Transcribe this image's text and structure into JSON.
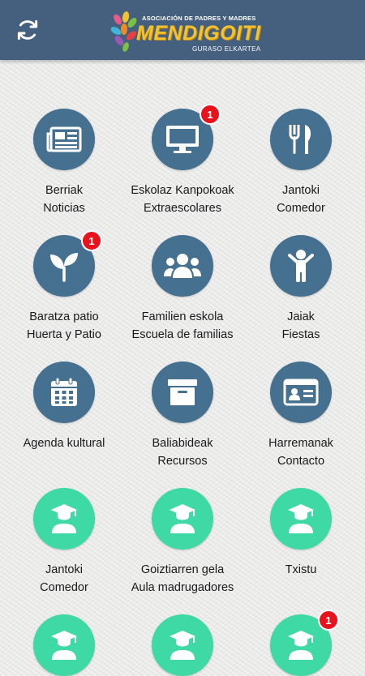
{
  "header": {
    "logo_top": "ASOCIACIÓN DE PADRES Y MADRES",
    "logo_main": "MENDIGOITI",
    "logo_sub": "GURASO ELKARTEA"
  },
  "colors": {
    "header_bg": "#45607e",
    "blue_circle": "#45708f",
    "teal_circle": "#3fd9a6",
    "badge": "#e8121c"
  },
  "tiles": [
    {
      "line1": "Berriak",
      "line2": "Noticias",
      "icon": "newspaper-icon",
      "badge": null
    },
    {
      "line1": "Eskolaz Kanpokoak",
      "line2": "Extraescolares",
      "icon": "monitor-icon",
      "badge": "1"
    },
    {
      "line1": "Jantoki",
      "line2": "Comedor",
      "icon": "fork-knife-icon",
      "badge": null
    },
    {
      "line1": "Baratza patio",
      "line2": "Huerta y Patio",
      "icon": "sprout-icon",
      "badge": "1"
    },
    {
      "line1": "Familien eskola",
      "line2": "Escuela de familias",
      "icon": "group-icon",
      "badge": null
    },
    {
      "line1": "Jaiak",
      "line2": "Fiestas",
      "icon": "child-icon",
      "badge": null
    },
    {
      "line1": "Agenda kultural",
      "line2": "",
      "icon": "calendar-icon",
      "badge": null
    },
    {
      "line1": "Baliabideak",
      "line2": "Recursos",
      "icon": "archive-box-icon",
      "badge": null
    },
    {
      "line1": "Harremanak",
      "line2": "Contacto",
      "icon": "id-card-icon",
      "badge": null
    },
    {
      "line1": "Jantoki",
      "line2": "Comedor",
      "icon": "graduate-icon",
      "badge": null
    },
    {
      "line1": "Goiztiarren gela",
      "line2": "Aula madrugadores",
      "icon": "graduate-icon",
      "badge": null
    },
    {
      "line1": "Txistu",
      "line2": "",
      "icon": "graduate-icon",
      "badge": null
    },
    {
      "line1": "",
      "line2": "",
      "icon": "graduate-icon",
      "badge": null
    },
    {
      "line1": "",
      "line2": "",
      "icon": "graduate-icon",
      "badge": null
    },
    {
      "line1": "",
      "line2": "",
      "icon": "graduate-icon",
      "badge": "1"
    }
  ]
}
